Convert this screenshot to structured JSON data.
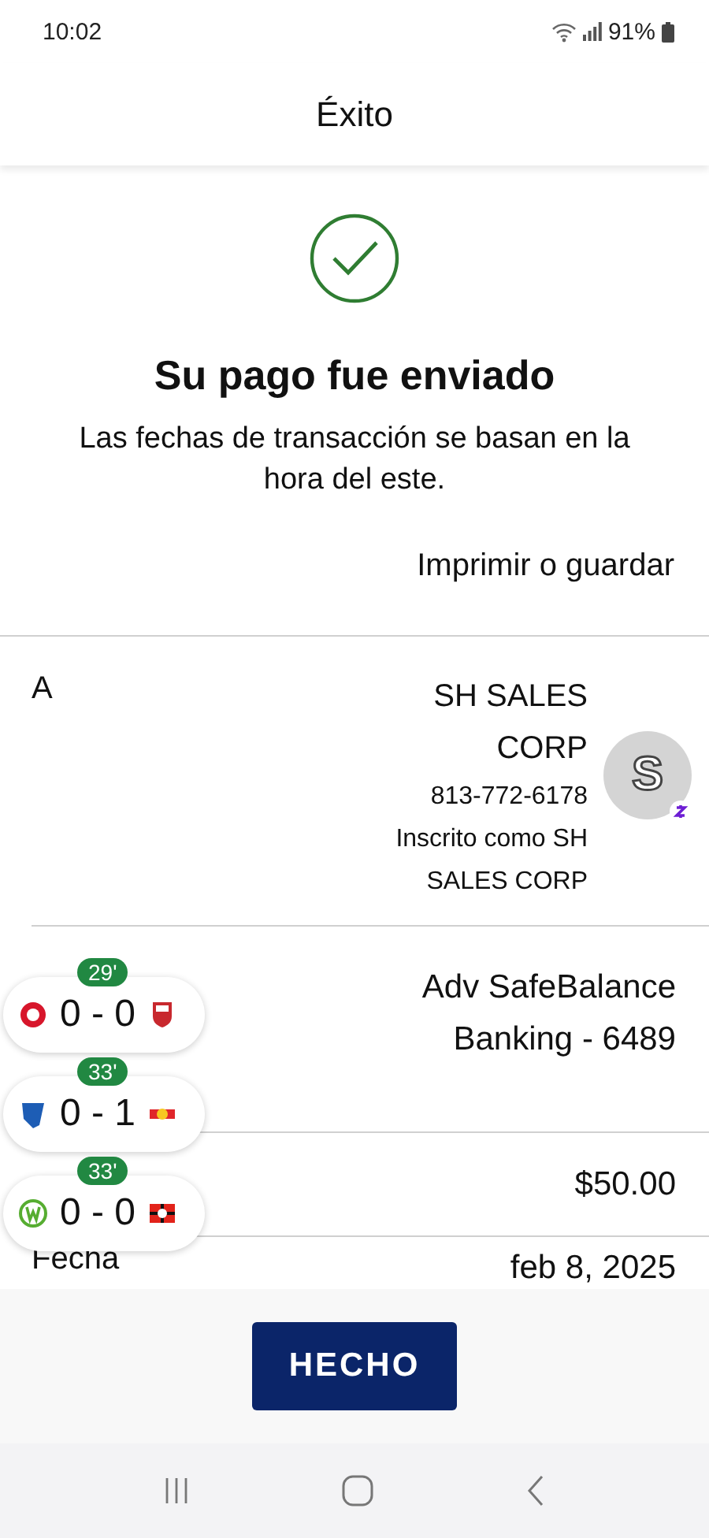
{
  "status_bar": {
    "time": "10:02",
    "battery": "91%"
  },
  "header": {
    "title": "Éxito"
  },
  "confirmation": {
    "title": "Su pago fue enviado",
    "message": "Las fechas de transacción se basan en la hora del este.",
    "print_link": "Imprimir o guardar"
  },
  "details": [
    {
      "kind": "payee",
      "label": "A",
      "value": "SH SALES CORP",
      "phone": "813-772-6178",
      "enrolled": "Inscrito como SH SALES CORP",
      "avatar_letter": "S"
    },
    {
      "kind": "account",
      "value": "Adv SafeBalance Banking - 6489"
    },
    {
      "kind": "amount",
      "value": "$50.00"
    },
    {
      "kind": "date",
      "label": "Fecha",
      "value": "feb 8, 2025"
    }
  ],
  "live_scores": [
    {
      "minute": "29'",
      "score": "0 - 0"
    },
    {
      "minute": "33'",
      "score": "0 - 1"
    },
    {
      "minute": "33'",
      "score": "0 - 0"
    }
  ],
  "footer": {
    "button": "HECHO"
  }
}
